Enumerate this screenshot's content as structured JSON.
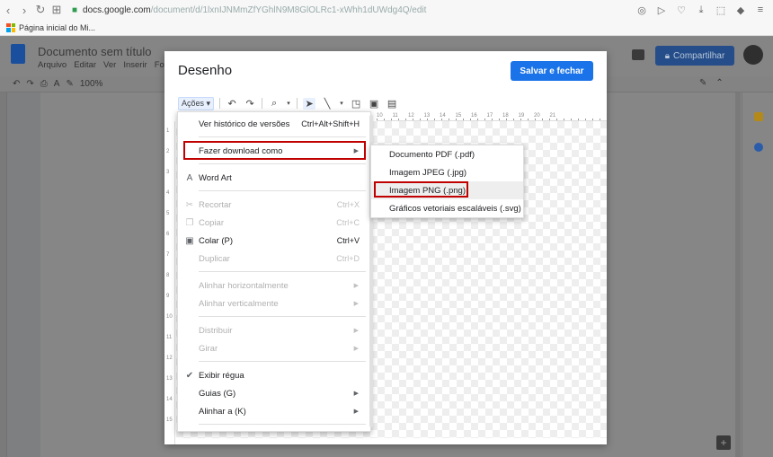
{
  "browser": {
    "url_prefix": "docs.google.com",
    "url_rest": "/document/d/1lxnIJNMmZfYGhlN9M8GlOLRc1-xWhh1dUWdg4Q/edit",
    "bookmark_label": "Página inicial do Mi..."
  },
  "docs": {
    "title": "Documento sem título",
    "menu": [
      "Arquivo",
      "Editar",
      "Ver",
      "Inserir",
      "For"
    ],
    "share_label": "Compartilhar",
    "zoom": "100%"
  },
  "dialog": {
    "title": "Desenho",
    "save_label": "Salvar e fechar",
    "actions_label": "Ações ▾"
  },
  "ruler": {
    "h": [
      "10",
      "11",
      "12",
      "13",
      "14",
      "15",
      "16",
      "17",
      "18",
      "19",
      "20",
      "21"
    ],
    "v": [
      "1",
      "2",
      "3",
      "4",
      "5",
      "6",
      "7",
      "8",
      "9",
      "10",
      "11",
      "12",
      "13",
      "14",
      "15"
    ]
  },
  "menu": {
    "history_label": "Ver histórico de versões",
    "history_shortcut": "Ctrl+Alt+Shift+H",
    "download_label": "Fazer download como",
    "wordart_label": "Word Art",
    "cut_label": "Recortar",
    "cut_shortcut": "Ctrl+X",
    "copy_label": "Copiar",
    "copy_shortcut": "Ctrl+C",
    "paste_label": "Colar (P)",
    "paste_shortcut": "Ctrl+V",
    "duplicate_label": "Duplicar",
    "duplicate_shortcut": "Ctrl+D",
    "align_h_label": "Alinhar horizontalmente",
    "align_v_label": "Alinhar verticalmente",
    "distribute_label": "Distribuir",
    "rotate_label": "Girar",
    "show_ruler_label": "Exibir régua",
    "guides_label": "Guias (G)",
    "align_to_label": "Alinhar a (K)"
  },
  "submenu": {
    "pdf": "Documento PDF (.pdf)",
    "jpeg": "Imagem JPEG (.jpg)",
    "png": "Imagem PNG (.png)",
    "svg": "Gráficos vetoriais escaláveis (.svg)"
  },
  "colors": {
    "accent": "#1a73e8",
    "highlight": "#c00000"
  }
}
